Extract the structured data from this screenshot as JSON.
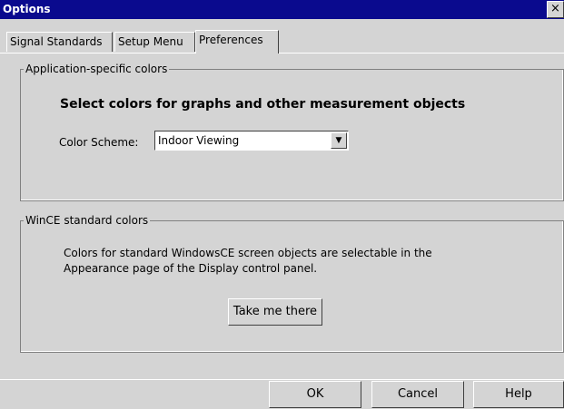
{
  "window": {
    "title": "Options",
    "close_glyph": "×"
  },
  "tabs": [
    {
      "label": "Signal Standards"
    },
    {
      "label": "Setup Menu"
    },
    {
      "label": "Preferences"
    }
  ],
  "app_colors": {
    "legend": "Application-specific colors",
    "heading": "Select colors for graphs and other measurement objects",
    "scheme_label": "Color Scheme:",
    "scheme_value": "Indoor Viewing"
  },
  "wince_colors": {
    "legend": "WinCE standard colors",
    "description_line1": "Colors for standard WindowsCE screen objects are selectable in the",
    "description_line2": "Appearance page of the Display control panel.",
    "button": "Take me there"
  },
  "footer": {
    "ok": "OK",
    "cancel": "Cancel",
    "help": "Help"
  },
  "colors": {
    "titlebar": "#0a0a8e",
    "face": "#d4d4d4"
  }
}
